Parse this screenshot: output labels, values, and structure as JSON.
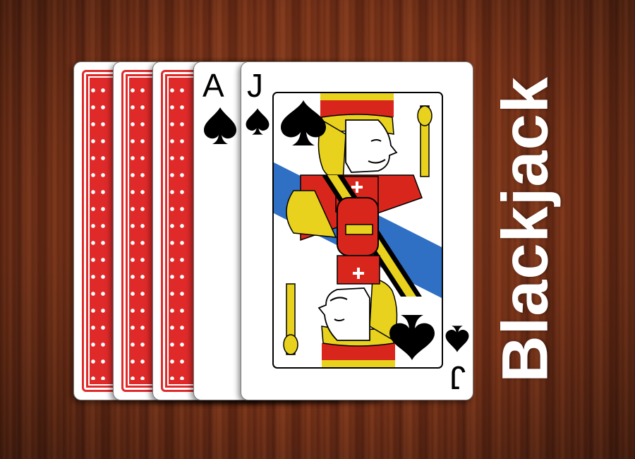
{
  "title": "Blackjack",
  "colors": {
    "back_red": "#e02a2a",
    "table_wood": "#6a2a13",
    "title_text": "#ffffff",
    "jack_red": "#d9261c",
    "jack_yellow": "#e8d21d",
    "jack_blue": "#2f6fc4"
  },
  "cards": [
    {
      "id": "back-1",
      "face": "down"
    },
    {
      "id": "back-2",
      "face": "down"
    },
    {
      "id": "back-3",
      "face": "down"
    },
    {
      "id": "ace",
      "face": "up",
      "rank": "A",
      "suit": "spade-icon"
    },
    {
      "id": "jack",
      "face": "up",
      "rank": "J",
      "suit": "spade-icon"
    }
  ],
  "ace_rank": "A",
  "jack_rank": "J"
}
